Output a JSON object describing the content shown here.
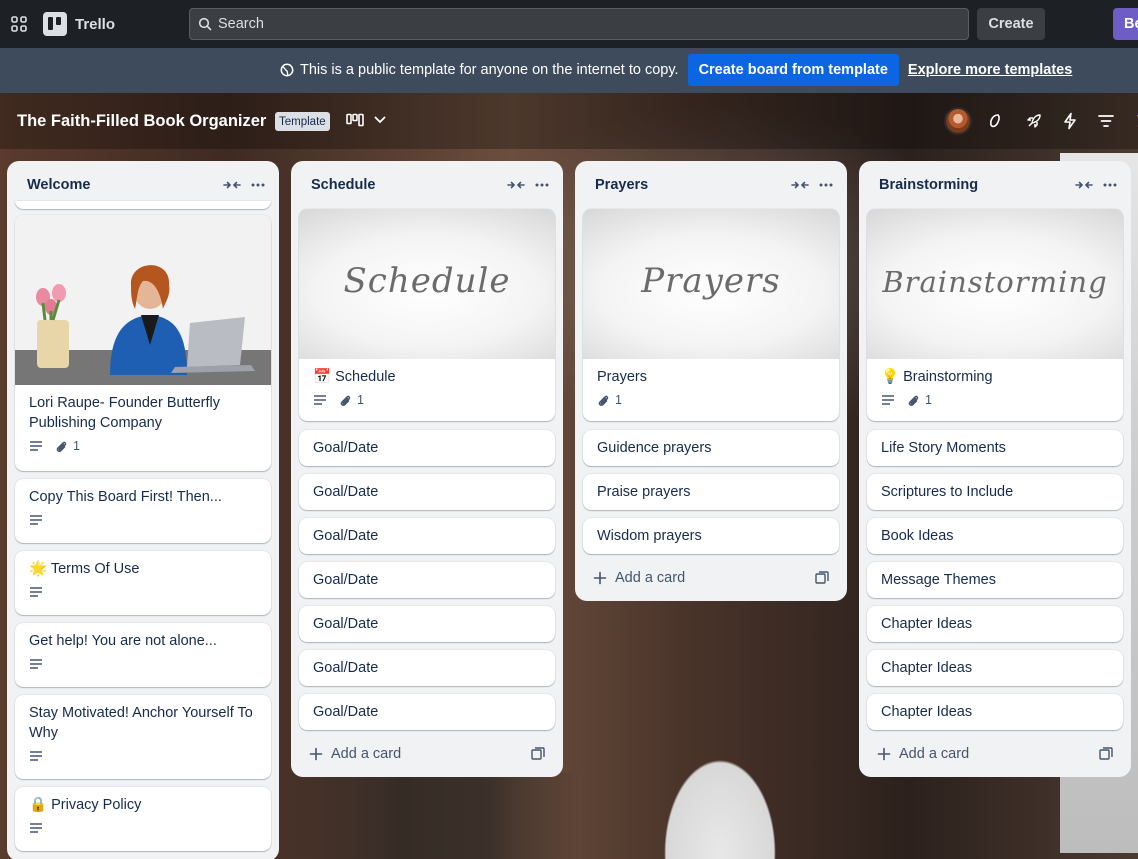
{
  "topnav": {
    "app_name": "Trello",
    "search_placeholder": "Search",
    "create_label": "Create",
    "extra_button_label": "Be"
  },
  "banner": {
    "text": "This is a public template for anyone on the internet to copy.",
    "create_from_template_label": "Create board from template",
    "explore_label": "Explore more templates"
  },
  "board": {
    "title": "The Faith-Filled Book Organizer",
    "badge": "Template"
  },
  "lists": [
    {
      "title": "Welcome",
      "cards": [
        {
          "title": "Lori Raupe- Founder Butterfly Publishing Company",
          "attachments": "1"
        },
        {
          "title": "Copy This Board First! Then..."
        },
        {
          "emoji": "🌟",
          "title": "Terms Of Use"
        },
        {
          "title": "Get help! You are not alone..."
        },
        {
          "title": "Stay Motivated! Anchor Yourself To Why"
        },
        {
          "emoji": "🔒",
          "title": "Privacy Policy"
        }
      ]
    },
    {
      "title": "Schedule",
      "cover_text": "Schedule",
      "cover_card": {
        "emoji": "📅",
        "title": "Schedule",
        "attachments": "1"
      },
      "cards": [
        "Goal/Date",
        "Goal/Date",
        "Goal/Date",
        "Goal/Date",
        "Goal/Date",
        "Goal/Date",
        "Goal/Date"
      ],
      "add_card_label": "Add a card"
    },
    {
      "title": "Prayers",
      "cover_text": "Prayers",
      "cover_card": {
        "title": "Prayers",
        "attachments": "1"
      },
      "cards": [
        "Guidence prayers",
        "Praise prayers",
        "Wisdom prayers"
      ],
      "add_card_label": "Add a card"
    },
    {
      "title": "Brainstorming",
      "cover_text": "Brainstorming",
      "cover_card": {
        "emoji": "💡",
        "title": "Brainstorming",
        "attachments": "1"
      },
      "cards": [
        "Life Story Moments",
        "Scriptures to Include",
        "Book Ideas",
        "Message Themes",
        "Chapter Ideas",
        "Chapter Ideas",
        "Chapter Ideas"
      ],
      "add_card_label": "Add a card"
    }
  ]
}
